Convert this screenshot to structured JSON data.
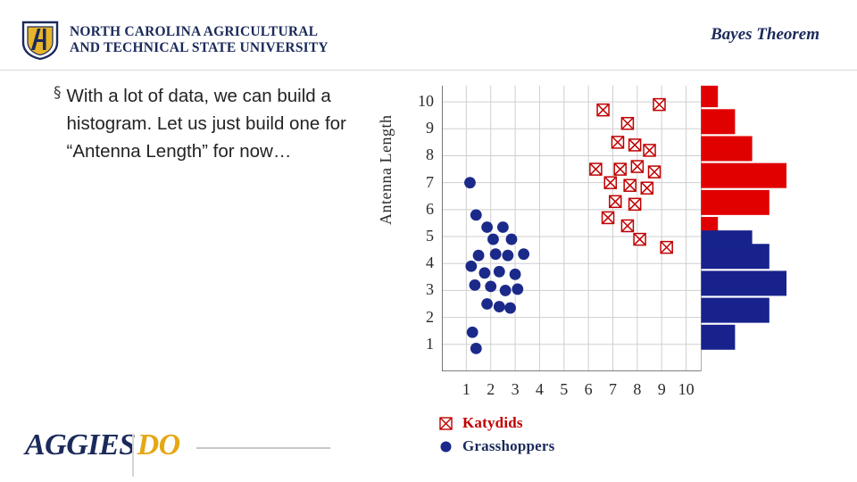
{
  "header": {
    "university_line1": "NORTH CAROLINA AGRICULTURAL",
    "university_line2": "AND TECHNICAL STATE UNIVERSITY",
    "slide_title": "Bayes Theorem",
    "logo_icon": "nc-at-shield-icon"
  },
  "body": {
    "bullet_marker": "§",
    "bullet_text": "With a lot of data, we can build a histogram. Let us just build one for “Antenna Length” for now…"
  },
  "footer": {
    "brand_primary": "AGGIES",
    "brand_accent": "DO"
  },
  "legend": [
    {
      "label": "Katydids",
      "color": "#c00000",
      "marker": "hatched-square-marker"
    },
    {
      "label": "Grasshoppers",
      "color": "#1b2a8a",
      "marker": "filled-circle-marker"
    }
  ],
  "chart_data": {
    "type": "scatter",
    "title": "",
    "xlabel": "",
    "ylabel": "Antenna Length",
    "xlim": [
      0,
      10.6
    ],
    "ylim": [
      0,
      10.6
    ],
    "xticks": [
      1,
      2,
      3,
      4,
      5,
      6,
      7,
      8,
      9,
      10
    ],
    "yticks": [
      1,
      2,
      3,
      4,
      5,
      6,
      7,
      8,
      9,
      10
    ],
    "grid": true,
    "legend_position": "below",
    "series": [
      {
        "name": "Grasshoppers",
        "color": "#1b2a8a",
        "marker": "circle",
        "points": [
          [
            1.15,
            7.0
          ],
          [
            1.4,
            5.8
          ],
          [
            1.85,
            5.35
          ],
          [
            2.5,
            5.35
          ],
          [
            2.1,
            4.9
          ],
          [
            2.85,
            4.9
          ],
          [
            1.5,
            4.3
          ],
          [
            2.2,
            4.35
          ],
          [
            2.7,
            4.3
          ],
          [
            3.35,
            4.35
          ],
          [
            1.2,
            3.9
          ],
          [
            1.75,
            3.65
          ],
          [
            2.35,
            3.7
          ],
          [
            3.0,
            3.6
          ],
          [
            1.35,
            3.2
          ],
          [
            2.0,
            3.15
          ],
          [
            2.6,
            3.0
          ],
          [
            3.1,
            3.05
          ],
          [
            1.85,
            2.5
          ],
          [
            2.35,
            2.4
          ],
          [
            2.8,
            2.35
          ],
          [
            1.25,
            1.45
          ],
          [
            1.4,
            0.85
          ]
        ]
      },
      {
        "name": "Katydids",
        "color": "#c00000",
        "marker": "hatched-square",
        "points": [
          [
            6.6,
            9.7
          ],
          [
            8.9,
            9.9
          ],
          [
            7.6,
            9.2
          ],
          [
            7.2,
            8.5
          ],
          [
            7.9,
            8.4
          ],
          [
            8.5,
            8.2
          ],
          [
            6.3,
            7.5
          ],
          [
            7.3,
            7.5
          ],
          [
            8.0,
            7.6
          ],
          [
            8.7,
            7.4
          ],
          [
            6.9,
            7.0
          ],
          [
            7.7,
            6.9
          ],
          [
            8.4,
            6.8
          ],
          [
            7.1,
            6.3
          ],
          [
            7.9,
            6.2
          ],
          [
            6.8,
            5.7
          ],
          [
            7.6,
            5.4
          ],
          [
            8.1,
            4.9
          ],
          [
            9.2,
            4.6
          ]
        ]
      }
    ],
    "histogram": {
      "orientation": "horizontal",
      "bins": [
        {
          "y": 10,
          "count": 1,
          "group": "Katydids",
          "color": "#e00000"
        },
        {
          "y": 9,
          "count": 2,
          "group": "Katydids",
          "color": "#e00000"
        },
        {
          "y": 8,
          "count": 3,
          "group": "Katydids",
          "color": "#e00000"
        },
        {
          "y": 7,
          "count": 5,
          "group": "Katydids",
          "color": "#e00000"
        },
        {
          "y": 6,
          "count": 4,
          "group": "Katydids",
          "color": "#e00000"
        },
        {
          "y": 5,
          "count": 1,
          "group": "Katydids",
          "color": "#e00000"
        },
        {
          "y": 4.5,
          "count": 3,
          "group": "Grasshoppers",
          "color": "#17228c"
        },
        {
          "y": 4,
          "count": 4,
          "group": "Grasshoppers",
          "color": "#17228c"
        },
        {
          "y": 3,
          "count": 5,
          "group": "Grasshoppers",
          "color": "#17228c"
        },
        {
          "y": 2,
          "count": 4,
          "group": "Grasshoppers",
          "color": "#17228c"
        },
        {
          "y": 1,
          "count": 2,
          "group": "Grasshoppers",
          "color": "#17228c"
        }
      ]
    }
  }
}
